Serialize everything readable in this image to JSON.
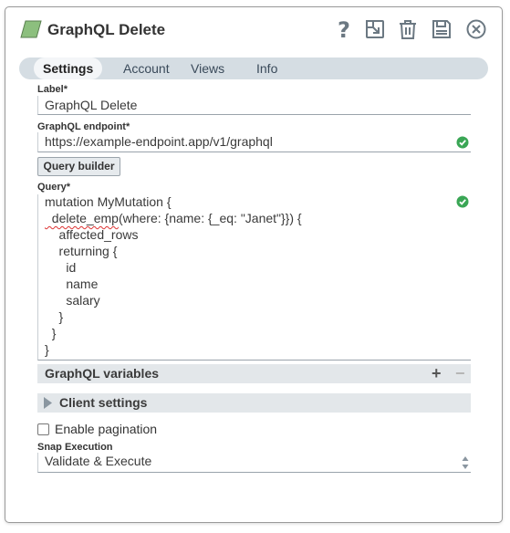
{
  "header": {
    "title": "GraphQL Delete",
    "icon_color": "#8cbf7e",
    "buttons": [
      "help-icon",
      "export-icon",
      "trash-icon",
      "save-icon",
      "close-icon"
    ]
  },
  "tabs": [
    {
      "label": "Settings",
      "active": true
    },
    {
      "label": "Account",
      "active": false
    },
    {
      "label": "Views",
      "active": false
    },
    {
      "label": "Info",
      "active": false
    }
  ],
  "fields": {
    "label": {
      "title": "Label*",
      "value": "GraphQL Delete"
    },
    "endpoint": {
      "title": "GraphQL endpoint*",
      "value": "https://example-endpoint.app/v1/graphql",
      "valid": true
    },
    "query_builder_label": "Query builder",
    "query": {
      "title": "Query*",
      "valid": true,
      "lines": [
        "mutation MyMutation {",
        "  delete_emp",
        "    affected_rows",
        "    returning {",
        "      id",
        "      name",
        "      salary",
        "    }",
        "  }",
        "}"
      ],
      "line2_rest": "(where: {name: {_eq: \"Janet\"}}) {"
    },
    "graphql_variables": {
      "title": "GraphQL variables",
      "add": "+",
      "remove": "−"
    },
    "client_settings": {
      "title": "Client settings"
    },
    "pagination": {
      "label": "Enable pagination",
      "checked": false
    },
    "snap_execution": {
      "title": "Snap Execution",
      "value": "Validate & Execute"
    }
  },
  "colors": {
    "valid_green": "#3aa655",
    "accent": "#d5dde3"
  }
}
